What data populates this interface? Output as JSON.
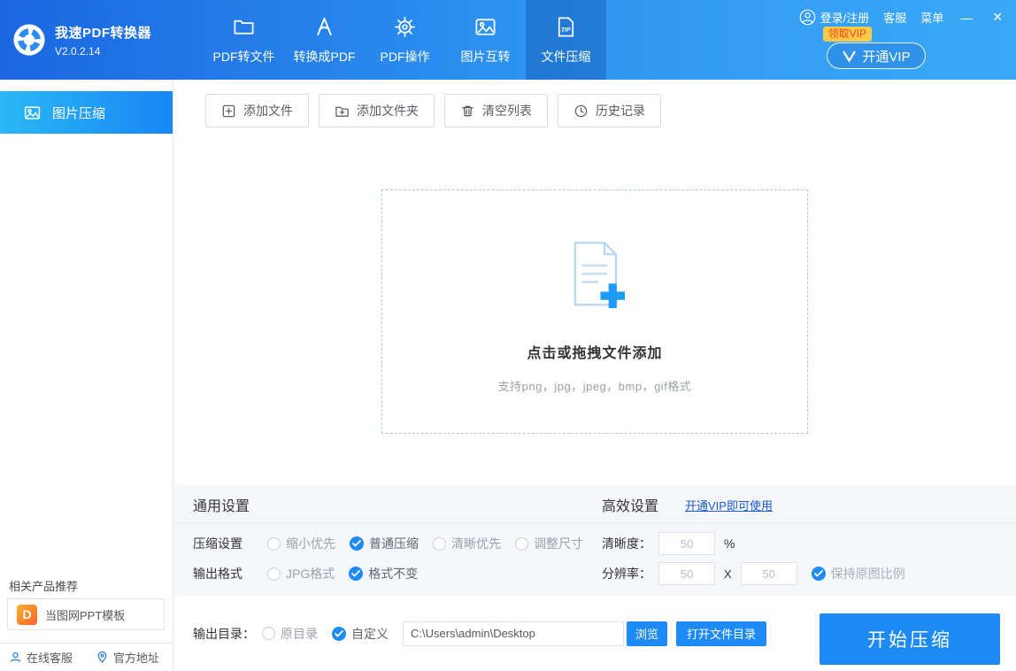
{
  "colors": {
    "accent_blue": "#1e8bf5",
    "header_gradient_left": "#1b67e0",
    "header_gradient_right": "#3ba8f6",
    "sidebar_active_left": "#2bb8f6",
    "sidebar_active_right": "#1786f3",
    "vip_badge_bg": "#fcc948",
    "vip_badge_text": "#f3441d",
    "settings_bg": "#f5f7fa",
    "link_blue": "#1a58d0"
  },
  "header": {
    "app_title": "我速PDF转换器",
    "version": "V2.0.2.14",
    "tabs": [
      {
        "label": "PDF转文件",
        "icon": "folder-icon",
        "active": false
      },
      {
        "label": "转换成PDF",
        "icon": "pdf-icon",
        "active": false
      },
      {
        "label": "PDF操作",
        "icon": "gear-icon",
        "active": false
      },
      {
        "label": "图片互转",
        "icon": "image-icon",
        "active": false
      },
      {
        "label": "文件压缩",
        "icon": "zip-icon",
        "icon_text": "ZIP",
        "active": true
      }
    ],
    "login_label": "登录/注册",
    "service_label": "客服",
    "menu_label": "菜单",
    "window_controls": {
      "minimize": "—",
      "close": "✕"
    },
    "vip_badge": "领取VIP",
    "vip_button": "开通VIP"
  },
  "sidebar": {
    "active_item": {
      "label": "图片压缩",
      "icon": "image-compress-icon"
    },
    "recommend_title": "相关产品推荐",
    "recommend_item": {
      "label": "当图网PPT模板",
      "logo_letter": "D"
    },
    "footer": {
      "online_service": "在线客服",
      "official_site": "官方地址"
    }
  },
  "toolbar": {
    "buttons": [
      {
        "label": "添加文件",
        "icon": "add-file-icon"
      },
      {
        "label": "添加文件夹",
        "icon": "add-folder-icon"
      },
      {
        "label": "清空列表",
        "icon": "trash-icon"
      },
      {
        "label": "历史记录",
        "icon": "clock-icon"
      }
    ]
  },
  "dropzone": {
    "title": "点击或拖拽文件添加",
    "subtitle": "支持png，jpg，jpeg，bmp，gif格式"
  },
  "settings": {
    "general": {
      "title": "通用设置",
      "compression": {
        "label": "压缩设置",
        "options": [
          {
            "label": "缩小优先",
            "selected": false
          },
          {
            "label": "普通压缩",
            "selected": true
          },
          {
            "label": "清晰优先",
            "selected": false
          },
          {
            "label": "调整尺寸",
            "selected": false
          }
        ]
      },
      "output_format": {
        "label": "输出格式",
        "options": [
          {
            "label": "JPG格式",
            "selected": false
          },
          {
            "label": "格式不变",
            "selected": true
          }
        ]
      }
    },
    "advanced": {
      "title": "高效设置",
      "vip_link": "开通VIP即可使用",
      "clarity": {
        "label": "清晰度：",
        "value": "50",
        "unit": "%"
      },
      "resolution": {
        "label": "分辨率：",
        "width": "50",
        "separator": "X",
        "height": "50"
      },
      "keep_ratio": {
        "label": "保持原图比例",
        "checked": true
      }
    }
  },
  "output_bar": {
    "label": "输出目录：",
    "options": [
      {
        "label": "原目录",
        "selected": false
      },
      {
        "label": "自定义",
        "selected": true
      }
    ],
    "path_value": "C:\\Users\\admin\\Desktop",
    "browse_label": "浏览",
    "open_dir_label": "打开文件目录",
    "start_label": "开始压缩"
  }
}
